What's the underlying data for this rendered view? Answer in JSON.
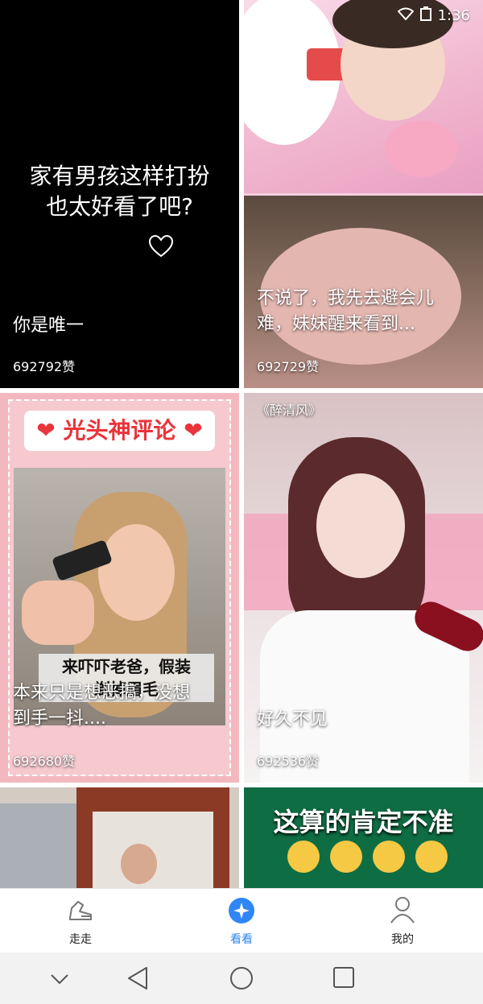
{
  "status_bar": {
    "time": "1:36"
  },
  "cards": [
    {
      "overlay": "家有男孩这样打扮\n也太好看了吧?",
      "title": "你是唯一",
      "likes": "692792赞"
    },
    {
      "title": "不说了，我先去避会儿\n难，妹妹醒来看到...",
      "likes": "692729赞"
    },
    {
      "banner": "光头神评论",
      "caption": "来吓吓老爸，假装\n剃掉眉毛",
      "title": "本来只是想恶搞，没想\n到手一抖....",
      "likes": "692680赞"
    },
    {
      "watermark": "《醉清风》",
      "title": "好久不见",
      "likes": "692536赞"
    },
    {},
    {
      "overlay": "这算的肯定不准"
    }
  ],
  "nav": {
    "tabs": [
      {
        "label": "走走"
      },
      {
        "label": "看看"
      },
      {
        "label": "我的"
      }
    ],
    "active_color": "#2f86f6"
  }
}
